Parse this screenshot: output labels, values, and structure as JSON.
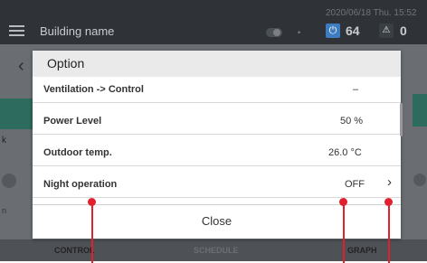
{
  "header": {
    "building_name": "Building name",
    "datetime": "2020/06/18 Thu. 15:52",
    "power_icon": "⏻",
    "power_count": "64",
    "warning_icon": "⚠",
    "warning_count": "0"
  },
  "background": {
    "left_label_k": "k",
    "left_label_n": "n"
  },
  "dialog": {
    "title": "Option",
    "rows": [
      {
        "label": "Ventilation -> Control",
        "value": "–"
      },
      {
        "label": "Power Level",
        "value": "50 %"
      },
      {
        "label": "Outdoor temp.",
        "value": "26.0 °C"
      },
      {
        "label": "Night operation",
        "value": "OFF"
      }
    ],
    "close_label": "Close"
  },
  "tabs": {
    "control": "CONTROL",
    "schedule": "SCHEDULE",
    "graph": "GRAPH"
  },
  "colors": {
    "accent_blue": "#3d7dbf",
    "teal": "#2c6b5d",
    "marker_red": "#e0212d"
  }
}
